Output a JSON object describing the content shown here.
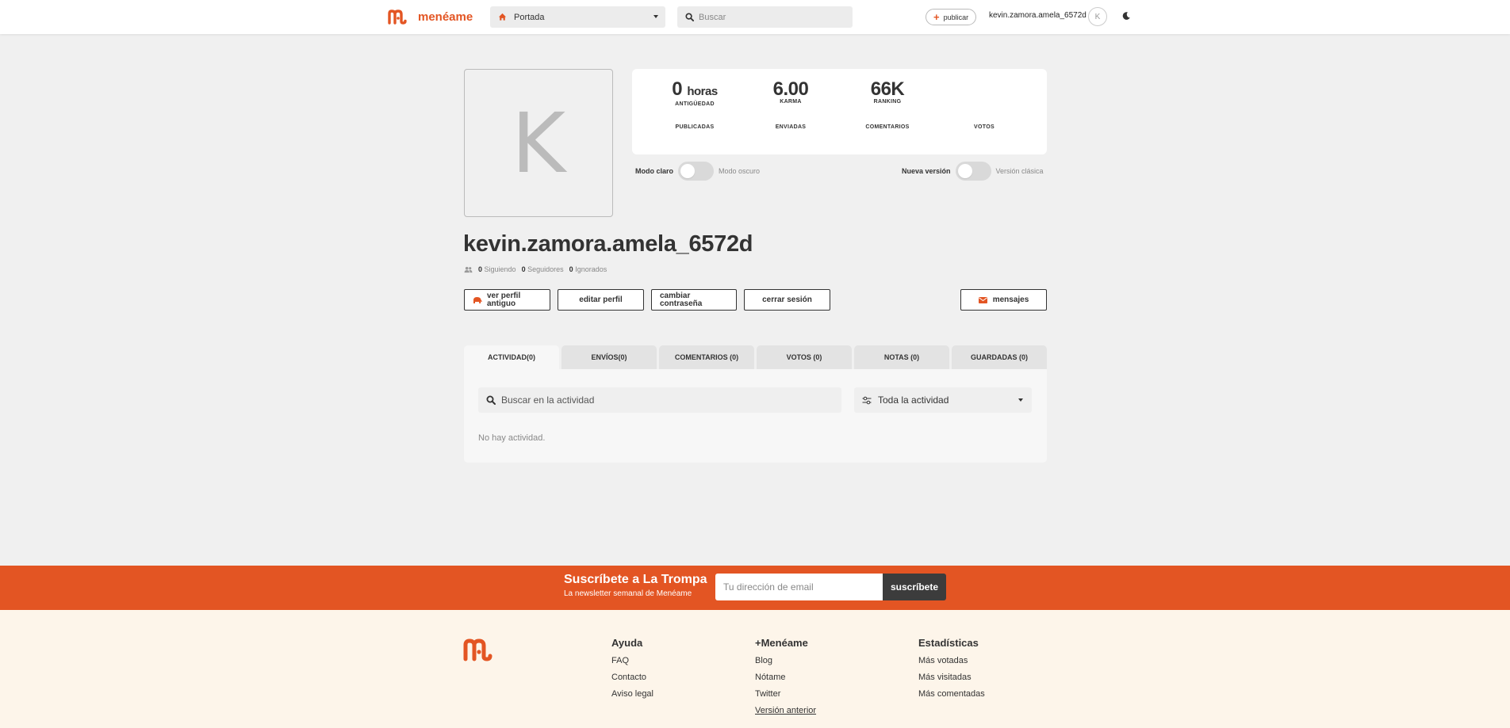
{
  "brand": {
    "name": "menéame",
    "color": "#e35523"
  },
  "header": {
    "section": "Portada",
    "search_placeholder": "Buscar",
    "publish_label": "publicar",
    "username": "kevin.zamora.amela_6572d",
    "avatar_letter": "K"
  },
  "profile": {
    "avatar_letter": "K",
    "name": "kevin.zamora.amela_6572d",
    "stats": [
      {
        "value": "0",
        "unit": "horas",
        "label": "ANTIGÜEDAD"
      },
      {
        "value": "6.00",
        "unit": "",
        "label": "KARMA"
      },
      {
        "value": "66K",
        "unit": "",
        "label": "RANKING"
      }
    ],
    "stats_row2": [
      "PUBLICADAS",
      "ENVIADAS",
      "COMENTARIOS",
      "VOTOS"
    ],
    "toggles": {
      "mode": {
        "on_label": "Modo claro",
        "off_label": "Modo oscuro"
      },
      "version": {
        "on_label": "Nueva versión",
        "off_label": "Versión clásica"
      }
    },
    "following_count": "0",
    "following_label": "Siguiendo",
    "followers_count": "0",
    "followers_label": "Seguidores",
    "ignored_count": "0",
    "ignored_label": "Ignorados",
    "buttons": {
      "old_profile": "ver perfil antiguo",
      "edit": "editar perfil",
      "change_password": "cambiar contraseña",
      "logout": "cerrar sesión",
      "messages": "mensajes"
    }
  },
  "tabs": [
    {
      "label": "ACTIVIDAD(0)",
      "active": true
    },
    {
      "label": "ENVÍOS(0)",
      "active": false
    },
    {
      "label": "COMENTARIOS (0)",
      "active": false
    },
    {
      "label": "VOTOS (0)",
      "active": false
    },
    {
      "label": "NOTAS (0)",
      "active": false
    },
    {
      "label": "GUARDADAS (0)",
      "active": false
    }
  ],
  "activity": {
    "search_placeholder": "Buscar en la actividad",
    "filter_selected": "Toda la actividad",
    "empty_text": "No hay actividad."
  },
  "newsletter": {
    "title": "Suscríbete a La Trompa",
    "subtitle": "La newsletter semanal de Menéame",
    "email_placeholder": "Tu dirección de email",
    "button": "suscríbete"
  },
  "footer": {
    "columns": [
      {
        "title": "Ayuda",
        "links": [
          "FAQ",
          "Contacto",
          "Aviso legal"
        ]
      },
      {
        "title": "+Menéame",
        "links": [
          "Blog",
          "Nótame",
          "Twitter",
          "Versión anterior"
        ]
      },
      {
        "title": "Estadísticas",
        "links": [
          "Más votadas",
          "Más visitadas",
          "Más comentadas"
        ]
      }
    ]
  }
}
